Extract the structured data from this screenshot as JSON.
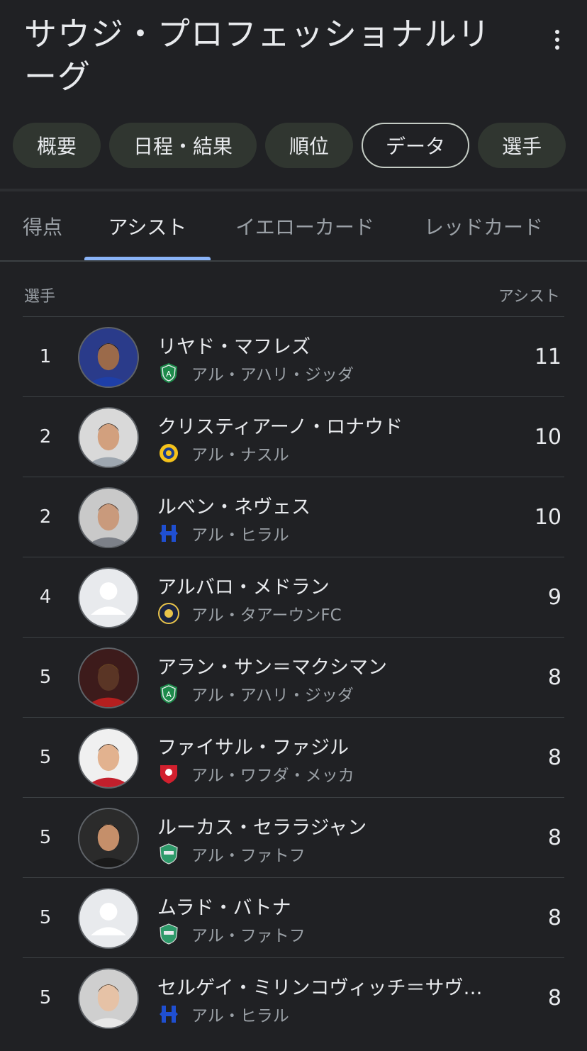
{
  "header": {
    "title": "サウジ・プロフェッショナルリーグ"
  },
  "chips": [
    {
      "label": "概要",
      "active": false
    },
    {
      "label": "日程・結果",
      "active": false
    },
    {
      "label": "順位",
      "active": false
    },
    {
      "label": "データ",
      "active": true
    },
    {
      "label": "選手",
      "active": false
    }
  ],
  "subtabs": [
    {
      "label": "得点",
      "active": false
    },
    {
      "label": "アシスト",
      "active": true
    },
    {
      "label": "イエローカード",
      "active": false
    },
    {
      "label": "レッドカード",
      "active": false
    }
  ],
  "table": {
    "col_player": "選手",
    "col_value": "アシスト",
    "rows": [
      {
        "rank": "1",
        "name": "リヤド・マフレズ",
        "team": "アル・アハリ・ジッダ",
        "value": "11",
        "team_logo": "al-ahli-crest-icon",
        "avatar": "player-photo"
      },
      {
        "rank": "2",
        "name": "クリスティアーノ・ロナウド",
        "team": "アル・ナスル",
        "value": "10",
        "team_logo": "al-nassr-crest-icon",
        "avatar": "player-photo"
      },
      {
        "rank": "2",
        "name": "ルベン・ネヴェス",
        "team": "アル・ヒラル",
        "value": "10",
        "team_logo": "al-hilal-crest-icon",
        "avatar": "player-photo"
      },
      {
        "rank": "4",
        "name": "アルバロ・メドラン",
        "team": "アル・タアーウンFC",
        "value": "9",
        "team_logo": "al-taawoun-crest-icon",
        "avatar": "placeholder"
      },
      {
        "rank": "5",
        "name": "アラン・サン＝マクシマン",
        "team": "アル・アハリ・ジッダ",
        "value": "8",
        "team_logo": "al-ahli-crest-icon",
        "avatar": "player-photo"
      },
      {
        "rank": "5",
        "name": "ファイサル・ファジル",
        "team": "アル・ワフダ・メッカ",
        "value": "8",
        "team_logo": "al-wehda-crest-icon",
        "avatar": "player-photo"
      },
      {
        "rank": "5",
        "name": "ルーカス・セララジャン",
        "team": "アル・ファトフ",
        "value": "8",
        "team_logo": "al-fateh-crest-icon",
        "avatar": "player-photo"
      },
      {
        "rank": "5",
        "name": "ムラド・バトナ",
        "team": "アル・ファトフ",
        "value": "8",
        "team_logo": "al-fateh-crest-icon",
        "avatar": "placeholder"
      },
      {
        "rank": "5",
        "name": "セルゲイ・ミリンコヴィッチ＝サヴ…",
        "team": "アル・ヒラル",
        "value": "8",
        "team_logo": "al-hilal-crest-icon",
        "avatar": "player-photo"
      }
    ]
  },
  "colors": {
    "background": "#202124",
    "chip": "#303630",
    "accent": "#8ab4f8",
    "text": "#e8eaed",
    "muted": "#9aa0a6"
  }
}
